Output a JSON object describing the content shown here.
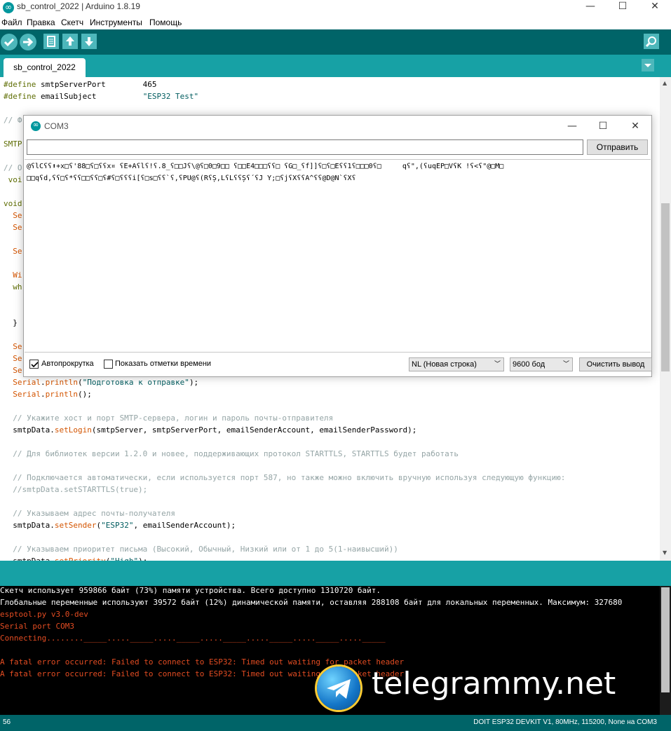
{
  "window": {
    "title": "sb_control_2022 | Arduino 1.8.19",
    "controls": [
      "—",
      "☐",
      "✕"
    ]
  },
  "menu": [
    "Файл",
    "Правка",
    "Скетч",
    "Инструменты",
    "Помощь"
  ],
  "tabs": {
    "active": "sb_control_2022"
  },
  "editor": {
    "lines": [
      [
        [
          "#define",
          "pre"
        ],
        [
          " smtpServerPort        465",
          ""
        ]
      ],
      [
        [
          "#define",
          "pre"
        ],
        [
          " emailSubject          ",
          ""
        ],
        [
          "\"ESP32 Test\"",
          "str"
        ]
      ],
      [
        [
          "",
          ""
        ]
      ],
      [
        [
          "// Ф",
          "cm"
        ]
      ],
      [
        [
          "",
          ""
        ]
      ],
      [
        [
          "SMTP",
          "pre"
        ]
      ],
      [
        [
          "",
          ""
        ]
      ],
      [
        [
          "// О",
          "cm"
        ]
      ],
      [
        [
          " voi",
          "pre"
        ]
      ],
      [
        [
          "",
          ""
        ]
      ],
      [
        [
          "void",
          "pre"
        ]
      ],
      [
        [
          "  ",
          ""
        ],
        [
          "Se",
          "fn"
        ]
      ],
      [
        [
          "  ",
          ""
        ],
        [
          "Se",
          "fn"
        ]
      ],
      [
        [
          "",
          ""
        ]
      ],
      [
        [
          "  ",
          ""
        ],
        [
          "Se",
          "fn"
        ]
      ],
      [
        [
          "",
          ""
        ]
      ],
      [
        [
          "  ",
          ""
        ],
        [
          "Wi",
          "fn"
        ]
      ],
      [
        [
          "  ",
          ""
        ],
        [
          "wh",
          "pre"
        ]
      ],
      [
        [
          "",
          ""
        ]
      ],
      [
        [
          "",
          ""
        ]
      ],
      [
        [
          "  }",
          ""
        ]
      ],
      [
        [
          "",
          ""
        ]
      ],
      [
        [
          "  ",
          ""
        ],
        [
          "Se",
          "fn"
        ]
      ],
      [
        [
          "  ",
          ""
        ],
        [
          "Se",
          "fn"
        ]
      ],
      [
        [
          "  ",
          ""
        ],
        [
          "Se",
          "fn"
        ]
      ],
      [
        [
          "  ",
          ""
        ],
        [
          "Serial",
          "fn"
        ],
        [
          ".",
          ""
        ],
        [
          "println",
          "fn"
        ],
        [
          "(",
          ""
        ],
        [
          "\"Подготовка к отправке\"",
          "str"
        ],
        [
          ");",
          ""
        ]
      ],
      [
        [
          "  ",
          ""
        ],
        [
          "Serial",
          "fn"
        ],
        [
          ".",
          ""
        ],
        [
          "println",
          "fn"
        ],
        [
          "();",
          ""
        ]
      ],
      [
        [
          "",
          ""
        ]
      ],
      [
        [
          "  // Укажите хост и порт SMTP-сервера, логин и пароль почты-отправителя",
          "cm"
        ]
      ],
      [
        [
          "  smtpData.",
          ""
        ],
        [
          "setLogin",
          "fn"
        ],
        [
          "(smtpServer, smtpServerPort, emailSenderAccount, emailSenderPassword);",
          ""
        ]
      ],
      [
        [
          "",
          ""
        ]
      ],
      [
        [
          "  // Для библиотек версии 1.2.0 и новее, поддерживающих протокол STARTTLS, STARTTLS будет работать",
          "cm"
        ]
      ],
      [
        [
          "",
          ""
        ]
      ],
      [
        [
          "  // Подключается автоматически, если используется порт 587, но также можно включить вручную используя следующую функцию:",
          "cm"
        ]
      ],
      [
        [
          "  //smtpData.setSTARTTLS(true);",
          "cm"
        ]
      ],
      [
        [
          "",
          ""
        ]
      ],
      [
        [
          "  // Указываем адрес почты-получателя",
          "cm"
        ]
      ],
      [
        [
          "  smtpData.",
          ""
        ],
        [
          "setSender",
          "fn"
        ],
        [
          "(",
          ""
        ],
        [
          "\"ESP32\"",
          "str"
        ],
        [
          ", emailSenderAccount);",
          ""
        ]
      ],
      [
        [
          "",
          ""
        ]
      ],
      [
        [
          "  // Указываем приоритет письма (Высокий, Обычный, Низкий или от 1 до 5(1-наивысший))",
          "cm"
        ]
      ],
      [
        [
          "  smtpData.",
          ""
        ],
        [
          "setPriority",
          "fn"
        ],
        [
          "(",
          ""
        ],
        [
          "\"High\"",
          "str"
        ],
        [
          ");",
          ""
        ]
      ]
    ]
  },
  "console": {
    "lines": [
      [
        "Скетч использует 959866 байт (73%) памяти устройства. Всего доступно 1310720 байт.",
        "#ffffff"
      ],
      [
        "Глобальные переменные используют 39572 байт (12%) динамической памяти, оставляя 288108 байт для локальных переменных. Максимум: 327680",
        "#ffffff"
      ],
      [
        "esptool.py v3.0-dev",
        "#e34c22"
      ],
      [
        "Serial port COM3",
        "#e34c22"
      ],
      [
        "Connecting........_____....._____....._____....._____....._____....._____....._____",
        "#e34c22"
      ],
      [
        "",
        "#e34c22"
      ],
      [
        "A fatal error occurred: Failed to connect to ESP32: Timed out waiting for packet header",
        "#e34c22"
      ],
      [
        "A fatal error occurred: Failed to connect to ESP32: Timed out waiting for packet header",
        "#e34c22"
      ]
    ]
  },
  "status": {
    "line": "56",
    "board": "DOIT ESP32 DEVKIT V1, 80MHz, 115200, None на COM3"
  },
  "serial_monitor": {
    "title": "COM3",
    "controls": [
      "—",
      "☐",
      "✕"
    ],
    "input_value": "",
    "send_label": "Отправить",
    "output": [
      "@ʕlCʕʕ⬆+x□ʕ'88□ʕ□ʕʕx¤ ʕE+Aʕlʕ!ʕ.8_ʕ□□Jʕ\\@ʕ□0□9□□ ʕ□□E4□□□ʕʕ□ ʕG□_ʕf]]ʕ□ʕ□Eʕʕ1ʕ□□□0ʕ□     qʕ\",(ʕuqEP□VʕK !ʕ<ʕ\"@□M□",
      "□□qʕd,ʕʕ□ʕ*ʕʕ□□ʕʕ□ʕ#ʕ□ʕʕʕi[ʕ□s□ʕʕ`ʕ,ʕPU@ʕ(RʕȘ,LʕLʕʕȘʕ´ʕJ Y;□ʕjʕXʕʕA^ʕʕ@D@N`ʕXʕ"
    ],
    "autoscroll": {
      "label": "Автопрокрутка",
      "checked": true
    },
    "timestamps": {
      "label": "Показать отметки времени",
      "checked": false
    },
    "line_ending": "NL (Новая строка)",
    "baud": "9600 бод",
    "clear_label": "Очистить вывод"
  },
  "watermark": "telegrammy.net",
  "colors": {
    "toolbar": "#006468",
    "tabstrip": "#17a1a5",
    "button": "#4db7bb",
    "console_error": "#e34c22"
  }
}
